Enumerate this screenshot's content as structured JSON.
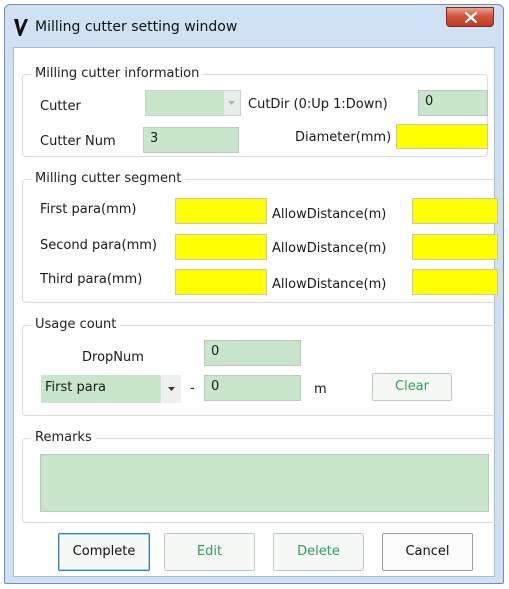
{
  "window": {
    "title": "Milling cutter setting window",
    "close_icon": "close-icon"
  },
  "cutter_info": {
    "legend": "Milling cutter information",
    "cutter_label": "Cutter",
    "cutter_value": "",
    "cutdir_label": "CutDir (0:Up 1:Down)",
    "cutdir_value": "0",
    "cutter_num_label": "Cutter Num",
    "cutter_num_value": "3",
    "diameter_label": "Diameter(mm)",
    "diameter_value": ""
  },
  "segment": {
    "legend": "Milling cutter segment",
    "rows": [
      {
        "para_label": "First para(mm)",
        "para_value": "",
        "allow_label": "AllowDistance(m)",
        "allow_value": ""
      },
      {
        "para_label": "Second para(mm)",
        "para_value": "",
        "allow_label": "AllowDistance(m)",
        "allow_value": ""
      },
      {
        "para_label": "Third para(mm)",
        "para_value": "",
        "allow_label": "AllowDistance(m)",
        "allow_value": ""
      }
    ]
  },
  "usage": {
    "legend": "Usage count",
    "dropnum_label": "DropNum",
    "dropnum_value": "0",
    "para_select": "First para",
    "dash": "-",
    "count_value": "0",
    "unit": "m",
    "clear_label": "Clear"
  },
  "remarks": {
    "legend": "Remarks",
    "value": ""
  },
  "buttons": {
    "complete": "Complete",
    "edit": "Edit",
    "delete": "Delete",
    "cancel": "Cancel"
  },
  "colors": {
    "field_green": "#c8e6cc",
    "field_yellow": "#ffff00",
    "button_green_text": "#2aa25a",
    "title_bar": "#cfe1f3"
  }
}
